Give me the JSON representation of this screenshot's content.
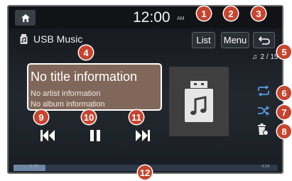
{
  "status_bar": {
    "clock": "12:00",
    "ampm": "AM"
  },
  "header": {
    "source_label": "USB Music",
    "list_label": "List",
    "menu_label": "Menu"
  },
  "playback": {
    "track_counter": "2 / 15",
    "title": "No title information",
    "artist": "No artist information",
    "album": "No album information",
    "elapsed": "0:30",
    "duration": "4:04",
    "progress_fraction": 0.12
  },
  "callouts": [
    "1",
    "2",
    "3",
    "4",
    "5",
    "6",
    "7",
    "8",
    "9",
    "10",
    "11",
    "12"
  ],
  "colors": {
    "callout": "#c8442d",
    "info_box": "#81675a",
    "progress_fill": "#6d86a3"
  }
}
